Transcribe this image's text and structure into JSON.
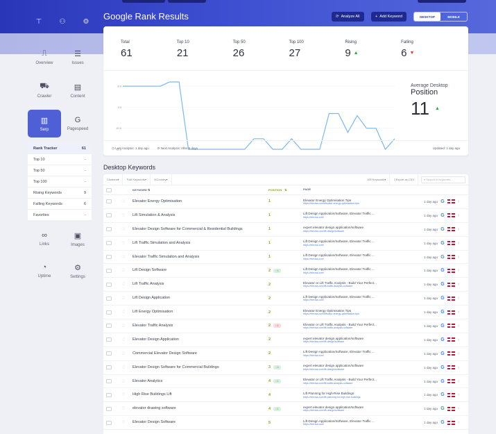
{
  "header": {
    "title": "Google Rank Results",
    "analyze_label": "Analyze All",
    "add_keyword_label": "Add Keyword",
    "toggle": [
      "DESKTOP",
      "MOBILE"
    ]
  },
  "sidebar": {
    "nav": [
      {
        "label": "Overview",
        "icon": "chart-icon"
      },
      {
        "label": "Issues",
        "icon": "list-icon"
      },
      {
        "label": "Crawler",
        "icon": "crawler-icon"
      },
      {
        "label": "Content",
        "icon": "content-icon"
      },
      {
        "label": "Serp",
        "icon": "serp-icon"
      },
      {
        "label": "Pagespeed",
        "icon": "google-icon"
      }
    ],
    "sub": [
      {
        "label": "Rank Tracker",
        "count": "61"
      },
      {
        "label": "Top 10",
        "count": "-"
      },
      {
        "label": "Top 50",
        "count": "-"
      },
      {
        "label": "Top 100",
        "count": "-"
      },
      {
        "label": "Rising Keywords",
        "count": "9"
      },
      {
        "label": "Falling Keywords",
        "count": "6"
      },
      {
        "label": "Favorites",
        "count": "-"
      }
    ],
    "nav2": [
      {
        "label": "Links",
        "icon": "link-icon"
      },
      {
        "label": "Images",
        "icon": "image-icon"
      },
      {
        "label": "Uptime",
        "icon": "gauge-icon"
      },
      {
        "label": "Settings",
        "icon": "gear-icon"
      }
    ]
  },
  "stats": [
    {
      "label": "Total",
      "value": "61",
      "trend": ""
    },
    {
      "label": "Top 10",
      "value": "21",
      "trend": ""
    },
    {
      "label": "Top 50",
      "value": "26",
      "trend": ""
    },
    {
      "label": "Top 100",
      "value": "27",
      "trend": ""
    },
    {
      "label": "Rising",
      "value": "9",
      "trend": "up"
    },
    {
      "label": "Falling",
      "value": "6",
      "trend": "down"
    }
  ],
  "average": {
    "line1": "Average Desktop",
    "line2": "Position",
    "value": "11",
    "trend": "up"
  },
  "card_footer": {
    "last_analysis": "Last Analysis: 1 day ago",
    "next_analysis": "Next Analysis: After 6 days",
    "updated": "Updated: 1 day ago"
  },
  "chart_data": {
    "type": "line",
    "yticks": [
      "8.0",
      "9.0",
      "10.0",
      "11.0"
    ],
    "y_range": [
      7.8,
      11.0
    ],
    "values": [
      8.0,
      8.0,
      8.0,
      8.0,
      8.0,
      7.8,
      7.8,
      11.0,
      11.0,
      11.0,
      11.0,
      11.0,
      11.0,
      11.0,
      10.5,
      10.5,
      11.0,
      11.0,
      10.5,
      11.0,
      11.0,
      11.0,
      9.3,
      9.3,
      10.2,
      9.4,
      10.0,
      10.0,
      11.0,
      10.5
    ],
    "color": "#7bb8ee"
  },
  "keywords": {
    "title": "Desktop Keywords",
    "toolbar": {
      "actions": "Actions",
      "all_keywords": "All Keywords",
      "country": "Country",
      "per_page": "100 Keywords",
      "export": "Export as CSV",
      "search_placeholder": "Search in keywords..."
    },
    "columns": {
      "keyword": "KEYWORD",
      "position": "POSITION",
      "page": "PAGE"
    },
    "rows": [
      {
        "kw": "Elevator Energy Optimisation",
        "pos": "1",
        "chg": "",
        "chg_type": "",
        "title": "Elevator Energy Optimisation Tips",
        "url": "https://elevisa.com/elevator-energy-optimisation-tips",
        "date": "1 day ago"
      },
      {
        "kw": "Lift Simulation & Analysis",
        "pos": "1",
        "chg": "",
        "chg_type": "",
        "title": "Lift Design Application/Software, Elevator Traffic ...",
        "url": "https://elevisa.com/",
        "date": "1 day ago"
      },
      {
        "kw": "Elevator Design Software for Commercial & Residential Buildings",
        "pos": "1",
        "chg": "",
        "chg_type": "",
        "title": "expert elevator design application/software",
        "url": "https://elevisa.com/lift-design/software",
        "date": "1 day ago"
      },
      {
        "kw": "Lift Traffic Simulation and Analysis",
        "pos": "1",
        "chg": "",
        "chg_type": "",
        "title": "Lift Design Application/Software, Elevator Traffic ...",
        "url": "https://elevisa.com/",
        "date": "1 day ago"
      },
      {
        "kw": "Elevator Traffic Simulation and Analysis",
        "pos": "1",
        "chg": "",
        "chg_type": "",
        "title": "Lift Design Application/Software, Elevator Traffic ...",
        "url": "https://elevisa.com/",
        "date": "1 day ago"
      },
      {
        "kw": "Lift Design Software",
        "pos": "2",
        "chg": "↑ 1",
        "chg_type": "g",
        "title": "Lift Design Application/Software, Elevator Traffic ...",
        "url": "https://elevisa.com/",
        "date": "1 day ago"
      },
      {
        "kw": "Lift Traffic Analysis",
        "pos": "2",
        "chg": "",
        "chg_type": "",
        "title": "Elevator or Lift Traffic Analysis - Build Your Perfect...",
        "url": "https://elevisa.com/lift-traffic-analysis-software",
        "date": "1 day ago"
      },
      {
        "kw": "Lift Design Application",
        "pos": "2",
        "chg": "",
        "chg_type": "",
        "title": "Lift Design Application/Software, Elevator Traffic ...",
        "url": "https://elevisa.com/",
        "date": "1 day ago"
      },
      {
        "kw": "Lift Energy Optimisation",
        "pos": "2",
        "chg": "",
        "chg_type": "",
        "title": "Elevator Energy Optimisation Tips",
        "url": "https://elevisa.com/elevator-energy-optimisation-tips",
        "date": "1 day ago"
      },
      {
        "kw": "Elevator Traffic Analysis",
        "pos": "2",
        "chg": "↓ 1",
        "chg_type": "r",
        "title": "Elevator or Lift Traffic Analysis - Build Your Perfect...",
        "url": "https://elevisa.com/lift-traffic-analysis-software",
        "date": "1 day ago"
      },
      {
        "kw": "Elevator Design Application",
        "pos": "2",
        "chg": "",
        "chg_type": "",
        "title": "expert elevator design application/software",
        "url": "https://elevisa.com/lift-design/software",
        "date": "1 day ago"
      },
      {
        "kw": "Commercial Elevator Design Software",
        "pos": "2",
        "chg": "",
        "chg_type": "",
        "title": "Lift Design Application/Software, Elevator Traffic ...",
        "url": "https://elevisa.com/",
        "date": "1 day ago"
      },
      {
        "kw": "Elevator Design Software for Commercial Buildings",
        "pos": "3",
        "chg": "↑ 1",
        "chg_type": "g",
        "title": "expert elevator design application/software",
        "url": "https://elevisa.com/lift-design/software",
        "date": "1 day ago"
      },
      {
        "kw": "Elevator Analytics",
        "pos": "4",
        "chg": "↑ 1",
        "chg_type": "g",
        "title": "Elevator or Lift Traffic Analysis - Build Your Perfect...",
        "url": "https://elevisa.com/lift-traffic-analysis-software",
        "date": "1 day ago"
      },
      {
        "kw": "High Rise Buildings Lift",
        "pos": "4",
        "chg": "",
        "chg_type": "",
        "title": "Lift Planning for High-Rise Buildings",
        "url": "https://elevisa.com/lift-planning-for-high-rise-buildings",
        "date": "1 day ago"
      },
      {
        "kw": "elevator drawing software",
        "pos": "4",
        "chg": "↑ 1",
        "chg_type": "g",
        "title": "expert elevator design application/software",
        "url": "https://elevisa.com/lift-design/software",
        "date": "1 day ago"
      },
      {
        "kw": "Elevator Design Software",
        "pos": "5",
        "chg": "",
        "chg_type": "",
        "title": "Lift Design Application/Software, Elevator Traffic ...",
        "url": "https://elevisa.com/",
        "date": "1 day ago"
      }
    ]
  }
}
